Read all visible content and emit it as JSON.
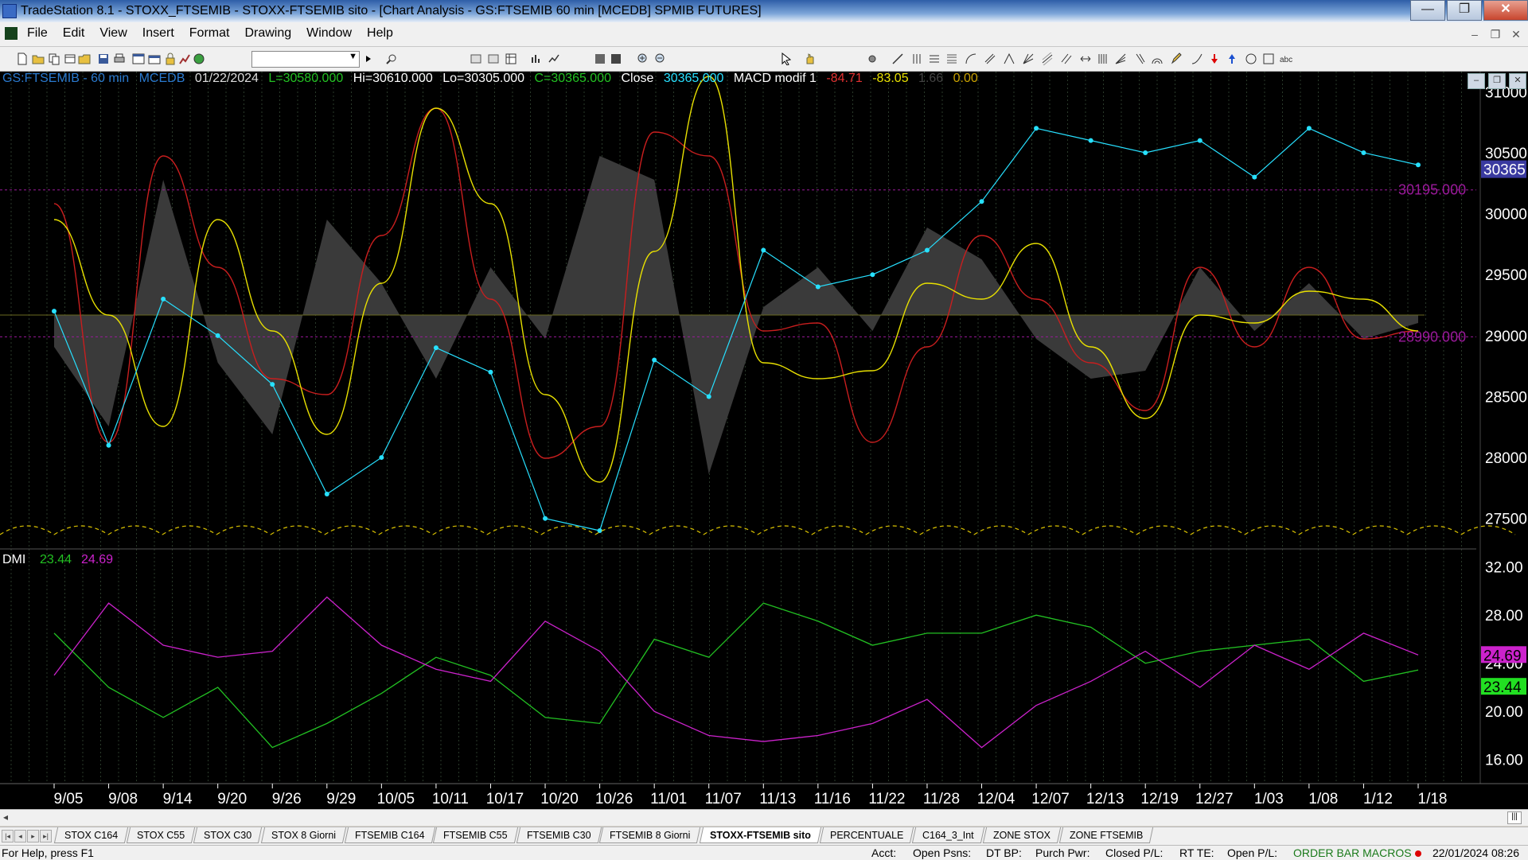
{
  "window": {
    "title": "TradeStation 8.1 - STOXX_FTSEMIB - STOXX-FTSEMIB sito - [Chart Analysis - GS:FTSEMIB  60 min  [MCEDB] SPMIB FUTURES]",
    "minimize": "—",
    "maximize": "❐",
    "close": "✕"
  },
  "menu": {
    "items": [
      "File",
      "Edit",
      "View",
      "Insert",
      "Format",
      "Drawing",
      "Window",
      "Help"
    ]
  },
  "header": {
    "symbol": "GS:FTSEMIB - 60 min",
    "data_network": "MCEDB",
    "date": "01/22/2024",
    "low_label": "L=30580.000",
    "high": "Hi=30610.000",
    "lo": "Lo=30305.000",
    "close_c": "C=30365.000",
    "close_word": "Close",
    "close_value": "30365.000",
    "indicator": "MACD modif 1",
    "macd_1": "-84.71",
    "macd_2": "-83.05",
    "macd_3": "1.66",
    "macd_4": "0.00"
  },
  "colors": {
    "background": "#000000",
    "price": "#27e0ff",
    "macd_red": "#c81e1e",
    "macd_yellow": "#e8e000",
    "histogram": "#3a3a3a",
    "dmi_plus": "#22c022",
    "dmi_minus": "#cc22cc",
    "ref_line": "#9a1a9a",
    "axis_text": "#ffffff"
  },
  "price_axis": {
    "labels": [
      "31000",
      "30500",
      "30000",
      "29500",
      "29000",
      "28500",
      "28000",
      "27500"
    ],
    "current_price": "30365",
    "line1": "30195.000",
    "line2": "28990.000"
  },
  "dmi": {
    "label": "DMI",
    "plus_value": "23.44",
    "minus_value": "24.69",
    "axis_labels": [
      "32.00",
      "28.00",
      "24.00",
      "20.00",
      "16.00"
    ]
  },
  "date_axis": {
    "labels": [
      "9/05",
      "9/08",
      "9/14",
      "9/20",
      "9/26",
      "9/29",
      "10/05",
      "10/11",
      "10/17",
      "10/20",
      "10/26",
      "11/01",
      "11/07",
      "11/13",
      "11/16",
      "11/22",
      "11/28",
      "12/04",
      "12/07",
      "12/13",
      "12/19",
      "12/27",
      "1/03",
      "1/08",
      "1/12",
      "1/18"
    ]
  },
  "chart_data": {
    "type": "line",
    "title": "GS:FTSEMIB - 60 min",
    "x": [
      "9/05",
      "9/08",
      "9/14",
      "9/20",
      "9/26",
      "9/29",
      "10/05",
      "10/11",
      "10/17",
      "10/20",
      "10/26",
      "11/01",
      "11/07",
      "11/13",
      "11/16",
      "11/22",
      "11/28",
      "12/04",
      "12/07",
      "12/13",
      "12/19",
      "12/27",
      "1/03",
      "1/08",
      "1/12",
      "1/18"
    ],
    "series": [
      {
        "values": [
          29200,
          28100,
          29300,
          29000,
          28600,
          27700,
          28000,
          28900,
          28700,
          27500,
          27400,
          28800,
          28500,
          29700,
          29400,
          29500,
          29700,
          30100,
          30700,
          30600,
          30500,
          30600,
          30300,
          30700,
          30500,
          30400
        ]
      }
    ],
    "ylim": [
      27250,
      31100
    ],
    "dmi": {
      "x": [
        "9/05",
        "9/08",
        "9/14",
        "9/20",
        "9/26",
        "9/29",
        "10/05",
        "10/11",
        "10/17",
        "10/20",
        "10/26",
        "11/01",
        "11/07",
        "11/13",
        "11/16",
        "11/22",
        "11/28",
        "12/04",
        "12/07",
        "12/13",
        "12/19",
        "12/27",
        "1/03",
        "1/08",
        "1/12",
        "1/18"
      ],
      "series": [
        {
          "values": [
            26.5,
            22.0,
            19.5,
            22.0,
            17.0,
            19.0,
            21.5,
            24.5,
            23.0,
            19.5,
            19.0,
            26.0,
            24.5,
            29.0,
            27.5,
            25.5,
            26.5,
            26.5,
            28.0,
            27.0,
            24.0,
            25.0,
            25.5,
            26.0,
            22.5,
            23.44
          ]
        },
        {
          "values": [
            23.0,
            29.0,
            25.5,
            24.5,
            25.0,
            29.5,
            25.5,
            23.5,
            22.5,
            27.5,
            25.0,
            20.0,
            18.0,
            17.5,
            18.0,
            19.0,
            21.0,
            17.0,
            20.5,
            22.5,
            25.0,
            22.0,
            25.5,
            23.5,
            26.5,
            24.69
          ]
        }
      ],
      "ylim": [
        14.0,
        33.5
      ]
    }
  },
  "tabs": {
    "items": [
      "STOX C164",
      "STOX C55",
      "STOX  C30",
      "STOX  8 Giorni",
      "FTSEMIB C164",
      "FTSEMIB C55",
      "FTSEMIB C30",
      "FTSEMIB  8 Giorni",
      "STOXX-FTSEMIB sito",
      "PERCENTUALE",
      "C164_3_Int",
      "ZONE STOX",
      "ZONE FTSEMIB"
    ],
    "active": "STOXX-FTSEMIB sito"
  },
  "status": {
    "help": "For Help, press F1",
    "acct": "Acct:",
    "open_psns": "Open Psns:",
    "dt_bp": "DT BP:",
    "purch_pwr": "Purch Pwr:",
    "closed_pl": "Closed P/L:",
    "rt_te": "RT TE:",
    "open_pl": "Open P/L:",
    "macros": "ORDER BAR  MACROS",
    "datetime": "22/01/2024 08:26"
  }
}
